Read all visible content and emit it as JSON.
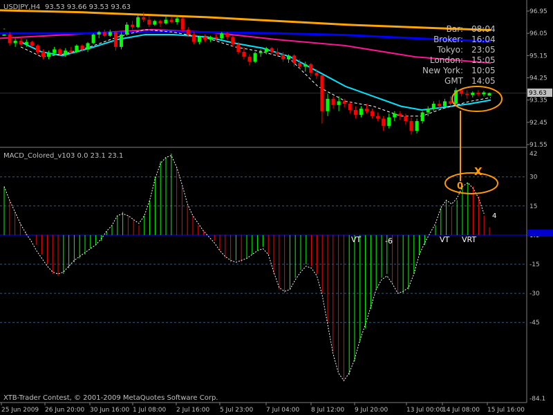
{
  "header": {
    "symbol": "USDJPY,H4",
    "ohlc": "93.53 93.66 93.53 93.63",
    "indicator": "MACD_Colored_v103 0.0 23.1 23.1",
    "copyright": "XTB-Trader Contest, © 2001-2009 MetaQuotes Software Corp."
  },
  "info_panel": {
    "rows": [
      {
        "label": "Bar:",
        "value": "08:04"
      },
      {
        "label": "Broker:",
        "value": "16:04"
      },
      {
        "label": "Tokyo:",
        "value": "23:05"
      },
      {
        "label": "London:",
        "value": "15:05"
      },
      {
        "label": "New York:",
        "value": "10:05"
      },
      {
        "label": "GMT",
        "value": "14:05"
      }
    ]
  },
  "price_axis": {
    "ticks": [
      "96.95",
      "96.05",
      "95.15",
      "94.25",
      "93.35",
      "92.45",
      "91.55"
    ],
    "current_price": "93.63"
  },
  "macd_axis": {
    "ticks": [
      "42",
      "30",
      "15",
      "0.0",
      "-15",
      "-30",
      "-45",
      "-84.1"
    ]
  },
  "time_axis": {
    "ticks": [
      "25 Jun 2009",
      "26 Jun 20:00",
      "30 Jun 16:00",
      "1 Jul 08:00",
      "2 Jul 16:00",
      "5 Jul 23:00",
      "7 Jul 04:00",
      "8 Jul 12:00",
      "9 Jul 20:00",
      "13 Jul 00:00",
      "14 Jul 08:00",
      "15 Jul 16:00"
    ]
  },
  "annotations": {
    "macd_labels": [
      "VT",
      "-6",
      "VT",
      "VRT"
    ],
    "macd_value_note": "4",
    "marker_x": "X",
    "marker_o": "0"
  },
  "colors": {
    "background": "#000000",
    "bull_candle": "#00ff00",
    "bear_candle": "#ff0000",
    "ma_orange": "#ffa500",
    "ma_blue": "#0000ff",
    "ma_magenta": "#ff1493",
    "ma_cyan": "#00e5ff",
    "ma_white": "#ffffff",
    "grid": "#30305a",
    "annotation": "#ff9900",
    "macd_zero": "#0000cd"
  },
  "chart_data": [
    {
      "type": "candlestick",
      "title": "USDJPY,H4",
      "ylim": [
        91.55,
        96.95
      ],
      "candles": [
        [
          95.95,
          96.25,
          96.2,
          96.0
        ],
        [
          96.0,
          96.1,
          95.55,
          95.65
        ],
        [
          95.65,
          95.85,
          95.5,
          95.75
        ],
        [
          95.75,
          95.9,
          95.55,
          95.6
        ],
        [
          95.6,
          95.8,
          95.5,
          95.7
        ],
        [
          95.7,
          95.75,
          95.5,
          95.55
        ],
        [
          95.55,
          95.6,
          95.2,
          95.3
        ],
        [
          95.3,
          95.4,
          95.0,
          95.1
        ],
        [
          95.1,
          95.35,
          95.0,
          95.25
        ],
        [
          95.25,
          95.5,
          95.15,
          95.4
        ],
        [
          95.4,
          95.45,
          95.15,
          95.2
        ],
        [
          95.2,
          95.45,
          95.1,
          95.35
        ],
        [
          95.35,
          95.5,
          95.2,
          95.3
        ],
        [
          95.3,
          95.6,
          95.25,
          95.55
        ],
        [
          95.55,
          95.6,
          95.3,
          95.4
        ],
        [
          95.4,
          95.7,
          95.3,
          95.65
        ],
        [
          95.65,
          96.05,
          95.6,
          96.0
        ],
        [
          96.0,
          96.15,
          95.85,
          96.1
        ],
        [
          96.1,
          96.2,
          95.9,
          95.95
        ],
        [
          95.95,
          96.2,
          95.9,
          96.1
        ],
        [
          96.1,
          96.15,
          95.35,
          95.5
        ],
        [
          95.5,
          96.1,
          95.4,
          96.0
        ],
        [
          96.0,
          96.5,
          95.95,
          96.4
        ],
        [
          96.4,
          96.55,
          96.2,
          96.3
        ],
        [
          96.3,
          96.8,
          96.25,
          96.7
        ],
        [
          96.7,
          96.9,
          96.5,
          96.6
        ],
        [
          96.6,
          96.75,
          96.3,
          96.4
        ],
        [
          96.4,
          96.6,
          96.35,
          96.55
        ],
        [
          96.55,
          96.6,
          96.3,
          96.45
        ],
        [
          96.45,
          96.75,
          96.4,
          96.6
        ],
        [
          96.6,
          96.7,
          96.45,
          96.5
        ],
        [
          96.5,
          96.75,
          96.4,
          96.65
        ],
        [
          96.65,
          96.7,
          96.1,
          96.2
        ],
        [
          96.2,
          96.3,
          95.9,
          96.0
        ],
        [
          96.0,
          96.1,
          95.6,
          95.7
        ],
        [
          95.7,
          95.95,
          95.6,
          95.9
        ],
        [
          95.9,
          96.0,
          95.7,
          95.8
        ],
        [
          95.8,
          95.95,
          95.7,
          95.9
        ],
        [
          95.9,
          96.0,
          95.75,
          95.85
        ],
        [
          95.85,
          96.1,
          95.8,
          96.05
        ],
        [
          96.05,
          96.1,
          95.8,
          95.9
        ],
        [
          95.9,
          95.95,
          95.5,
          95.6
        ],
        [
          95.6,
          95.7,
          95.2,
          95.3
        ],
        [
          95.3,
          95.5,
          95.0,
          95.1
        ],
        [
          95.1,
          95.2,
          94.75,
          94.9
        ],
        [
          94.9,
          95.3,
          94.85,
          95.25
        ],
        [
          95.25,
          95.4,
          95.1,
          95.3
        ],
        [
          95.3,
          95.5,
          95.2,
          95.45
        ],
        [
          95.45,
          95.5,
          95.2,
          95.3
        ],
        [
          95.3,
          95.45,
          95.1,
          95.2
        ],
        [
          95.2,
          95.3,
          94.9,
          95.0
        ],
        [
          95.0,
          95.2,
          94.85,
          95.15
        ],
        [
          95.15,
          95.2,
          94.7,
          94.85
        ],
        [
          94.85,
          95.0,
          94.6,
          94.7
        ],
        [
          94.7,
          94.9,
          94.5,
          94.8
        ],
        [
          94.8,
          94.85,
          94.3,
          94.45
        ],
        [
          94.45,
          94.6,
          94.2,
          94.35
        ],
        [
          94.35,
          94.4,
          92.4,
          92.9
        ],
        [
          92.9,
          93.6,
          92.7,
          93.4
        ],
        [
          93.4,
          93.5,
          93.0,
          93.15
        ],
        [
          93.15,
          93.5,
          92.9,
          93.3
        ],
        [
          93.3,
          93.4,
          93.05,
          93.2
        ],
        [
          93.2,
          93.3,
          92.8,
          92.95
        ],
        [
          92.95,
          93.1,
          92.6,
          92.75
        ],
        [
          92.75,
          93.1,
          92.65,
          93.0
        ],
        [
          93.0,
          93.2,
          92.8,
          92.9
        ],
        [
          92.9,
          93.0,
          92.6,
          92.7
        ],
        [
          92.7,
          92.85,
          92.5,
          92.6
        ],
        [
          92.6,
          92.7,
          92.1,
          92.3
        ],
        [
          92.3,
          92.8,
          92.2,
          92.65
        ],
        [
          92.65,
          92.9,
          92.5,
          92.8
        ],
        [
          92.8,
          92.9,
          92.55,
          92.7
        ],
        [
          92.7,
          92.8,
          92.35,
          92.5
        ],
        [
          92.5,
          92.65,
          91.95,
          92.1
        ],
        [
          92.1,
          92.6,
          92.0,
          92.5
        ],
        [
          92.5,
          92.9,
          92.4,
          92.85
        ],
        [
          92.85,
          93.1,
          92.7,
          93.0
        ],
        [
          93.0,
          93.3,
          92.9,
          93.2
        ],
        [
          93.2,
          93.35,
          93.0,
          93.1
        ],
        [
          93.1,
          93.4,
          93.0,
          93.3
        ],
        [
          93.3,
          93.5,
          93.1,
          93.2
        ],
        [
          93.2,
          93.85,
          93.15,
          93.75
        ],
        [
          93.75,
          93.8,
          93.5,
          93.6
        ],
        [
          93.6,
          93.75,
          93.4,
          93.55
        ],
        [
          93.55,
          93.7,
          93.45,
          93.65
        ],
        [
          93.65,
          93.75,
          93.5,
          93.58
        ],
        [
          93.58,
          93.72,
          93.5,
          93.66
        ],
        [
          93.53,
          93.66,
          93.53,
          93.63
        ]
      ],
      "ma_orange": [
        [
          0,
          96.98
        ],
        [
          120,
          96.9
        ],
        [
          300,
          96.7
        ],
        [
          500,
          96.4
        ],
        [
          640,
          96.25
        ],
        [
          710,
          96.18
        ]
      ],
      "ma_blue": [
        [
          0,
          96.05
        ],
        [
          120,
          96.05
        ],
        [
          240,
          96.12
        ],
        [
          400,
          96.05
        ],
        [
          500,
          95.98
        ],
        [
          600,
          95.85
        ],
        [
          710,
          95.72
        ]
      ],
      "ma_magenta": [
        [
          0,
          95.85
        ],
        [
          100,
          96.0
        ],
        [
          220,
          96.2
        ],
        [
          300,
          96.1
        ],
        [
          400,
          95.8
        ],
        [
          500,
          95.55
        ],
        [
          600,
          95.1
        ],
        [
          710,
          94.85
        ]
      ],
      "ma_cyan": [
        [
          30,
          95.7
        ],
        [
          60,
          95.3
        ],
        [
          90,
          95.15
        ],
        [
          130,
          95.45
        ],
        [
          170,
          95.8
        ],
        [
          210,
          96.0
        ],
        [
          250,
          96.0
        ],
        [
          300,
          95.9
        ],
        [
          340,
          95.65
        ],
        [
          380,
          95.45
        ],
        [
          420,
          95.1
        ],
        [
          460,
          94.5
        ],
        [
          500,
          93.9
        ],
        [
          540,
          93.5
        ],
        [
          580,
          93.1
        ],
        [
          610,
          92.95
        ],
        [
          640,
          93.05
        ],
        [
          680,
          93.2
        ],
        [
          710,
          93.35
        ]
      ],
      "ma_white": [
        [
          30,
          95.5
        ],
        [
          60,
          95.1
        ],
        [
          90,
          95.2
        ],
        [
          130,
          95.5
        ],
        [
          170,
          95.9
        ],
        [
          210,
          96.2
        ],
        [
          250,
          96.1
        ],
        [
          300,
          95.85
        ],
        [
          340,
          95.5
        ],
        [
          380,
          95.3
        ],
        [
          420,
          95.0
        ],
        [
          460,
          93.9
        ],
        [
          500,
          93.3
        ],
        [
          540,
          93.1
        ],
        [
          580,
          92.7
        ],
        [
          610,
          92.7
        ],
        [
          640,
          93.0
        ],
        [
          680,
          93.3
        ],
        [
          710,
          93.45
        ]
      ]
    },
    {
      "type": "bar",
      "title": "MACD_Colored_v103 0.0 23.1 23.1",
      "ylim": [
        -84.1,
        42
      ],
      "values": [
        25,
        18,
        12,
        6,
        2,
        0,
        -5,
        -10,
        -15,
        -20,
        -21,
        -20,
        -17,
        -14,
        -12,
        -10,
        -7,
        -5,
        -3,
        2,
        5,
        10,
        12,
        10,
        8,
        5,
        10,
        18,
        30,
        38,
        40,
        42,
        35,
        25,
        15,
        10,
        5,
        2,
        0,
        -3,
        -8,
        -12,
        -14,
        -13,
        -14,
        -12,
        -10,
        -8,
        -6,
        -10,
        -20,
        -28,
        -30,
        -28,
        -22,
        -18,
        -15,
        -16,
        -20,
        -30,
        -45,
        -60,
        -70,
        -75,
        -72,
        -65,
        -55,
        -48,
        -38,
        -28,
        -22,
        -20,
        -25,
        -30,
        -30,
        -28,
        -20,
        -10,
        -5,
        0,
        5,
        14,
        18,
        15,
        18,
        25,
        27,
        25,
        20,
        10,
        4
      ],
      "signal": [
        25,
        18,
        12,
        6,
        1,
        -3,
        -8,
        -12,
        -16,
        -19,
        -20,
        -19,
        -16,
        -13,
        -11,
        -9,
        -7,
        -5,
        -2,
        2,
        5,
        10,
        11,
        10,
        8,
        6,
        10,
        18,
        29,
        37,
        40,
        41,
        35,
        26,
        16,
        10,
        6,
        2,
        -1,
        -4,
        -8,
        -11,
        -13,
        -14,
        -13,
        -12,
        -10,
        -8,
        -7,
        -10,
        -19,
        -27,
        -29,
        -28,
        -23,
        -19,
        -16,
        -17,
        -21,
        -31,
        -46,
        -61,
        -71,
        -75,
        -71,
        -64,
        -54,
        -46,
        -37,
        -28,
        -23,
        -21,
        -25,
        -30,
        -29,
        -27,
        -20,
        -10,
        -4,
        1,
        6,
        14,
        18,
        16,
        19,
        25,
        27,
        24,
        19,
        11
      ]
    }
  ]
}
